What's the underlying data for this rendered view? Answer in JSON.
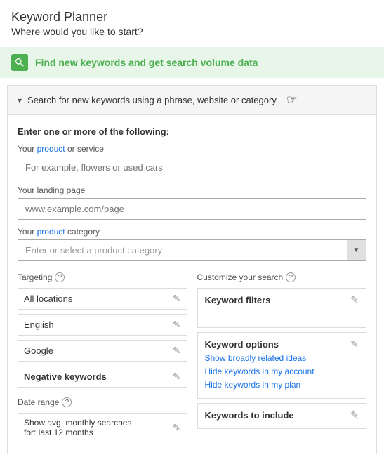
{
  "header": {
    "title": "Keyword Planner",
    "subtitle": "Where would you like to start?"
  },
  "find_bar": {
    "text": "Find new keywords and get search volume data"
  },
  "panel": {
    "header_text": "Search for new keywords using a phrase, website or category",
    "body_label": "Enter one or more of the following:",
    "product_label": "Your product or service",
    "product_placeholder": "For example, flowers or used cars",
    "landing_label": "Your landing page",
    "landing_placeholder": "www.example.com/page",
    "category_label": "Your product category",
    "category_placeholder": "Enter or select a product category"
  },
  "targeting": {
    "title": "Targeting",
    "items": [
      {
        "label": "All locations",
        "bold": false
      },
      {
        "label": "English",
        "bold": false
      },
      {
        "label": "Google",
        "bold": false
      },
      {
        "label": "Negative keywords",
        "bold": true
      }
    ]
  },
  "customize": {
    "title": "Customize your search",
    "items": [
      {
        "title": "Keyword filters",
        "links": []
      },
      {
        "title": "Keyword options",
        "links": [
          "Show broadly related ideas",
          "Hide keywords in my account",
          "Hide keywords in my plan"
        ]
      },
      {
        "title": "Keywords to include",
        "links": []
      }
    ]
  },
  "date_range": {
    "title": "Date range",
    "value": "Show avg. monthly searches for: last 12 months"
  },
  "icons": {
    "search": "🔍",
    "edit": "✎",
    "arrow_down": "▼",
    "help": "?",
    "triangle": "▸"
  }
}
